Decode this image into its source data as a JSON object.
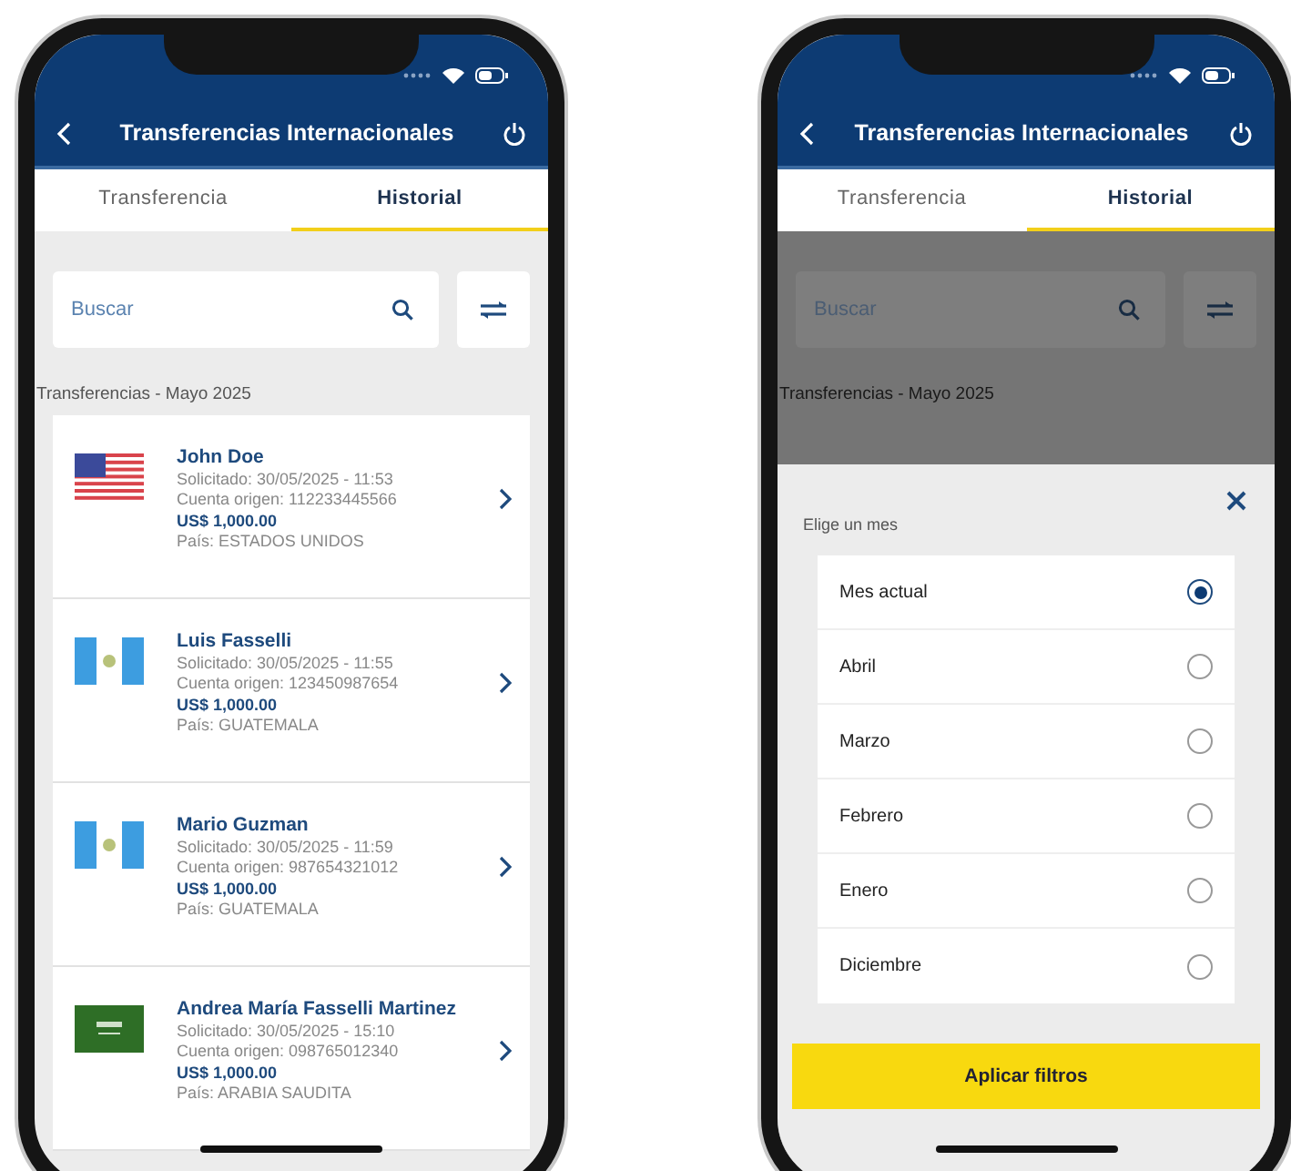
{
  "phones": [
    {
      "kind": "history",
      "header": {
        "title": "Transferencias Internacionales"
      },
      "tabs": [
        {
          "label": "Transferencia",
          "selected": false
        },
        {
          "label": "Historial",
          "selected": true
        }
      ],
      "search": {
        "placeholder": "Buscar"
      },
      "section_title": "Transferencias - Mayo 2025",
      "transfers": [
        {
          "kind": "usa",
          "name": "John Doe",
          "requested": "Solicitado: 30/05/2025 - 11:53",
          "account": "Cuenta origen: 112233445566",
          "amount": "US$ 1,000.00",
          "country": "País: ESTADOS UNIDOS"
        },
        {
          "kind": "guatemala",
          "name": "Luis Fasselli",
          "requested": "Solicitado: 30/05/2025 - 11:55",
          "account": "Cuenta origen: 123450987654",
          "amount": "US$ 1,000.00",
          "country": "País: GUATEMALA"
        },
        {
          "kind": "guatemala",
          "name": "Mario Guzman",
          "requested": "Solicitado: 30/05/2025 - 11:59",
          "account": "Cuenta origen: 987654321012",
          "amount": "US$ 1,000.00",
          "country": "País: GUATEMALA"
        },
        {
          "kind": "saudi",
          "name": "Andrea María Fasselli Martinez",
          "requested": "Solicitado: 30/05/2025 - 15:10",
          "account": "Cuenta origen: 098765012340",
          "amount": "US$ 1,000.00",
          "country": "País: ARABIA SAUDITA"
        }
      ]
    },
    {
      "kind": "month_picker",
      "header": {
        "title": "Transferencias Internacionales"
      },
      "tabs": [
        {
          "label": "Transferencia",
          "selected": false
        },
        {
          "label": "Historial",
          "selected": true
        }
      ],
      "search": {
        "placeholder": "Buscar"
      },
      "section_title": "Transferencias - Mayo 2025",
      "sheet": {
        "title": "Elige un mes",
        "options": [
          {
            "label": "Mes actual",
            "selected": true
          },
          {
            "label": "Abril",
            "selected": false
          },
          {
            "label": "Marzo",
            "selected": false
          },
          {
            "label": "Febrero",
            "selected": false
          },
          {
            "label": "Enero",
            "selected": false
          },
          {
            "label": "Diciembre",
            "selected": false
          }
        ],
        "apply_button": "Aplicar filtros"
      }
    }
  ]
}
